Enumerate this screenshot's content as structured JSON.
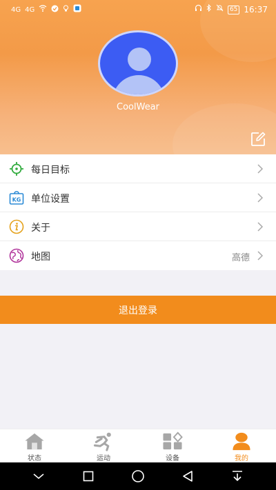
{
  "status_bar": {
    "left_signal_1": "4G",
    "left_signal_2": "4G",
    "battery": "65",
    "time": "16:37"
  },
  "profile": {
    "username": "CoolWear"
  },
  "menu": {
    "items": [
      {
        "label": "每日目标",
        "value": "",
        "icon": "target-icon",
        "color": "#2faa3c"
      },
      {
        "label": "单位设置",
        "value": "",
        "icon": "kg-icon",
        "color": "#2a8ad6"
      },
      {
        "label": "关于",
        "value": "",
        "icon": "info-icon",
        "color": "#e4a11a"
      },
      {
        "label": "地图",
        "value": "高德",
        "icon": "globe-icon",
        "color": "#b0339a"
      }
    ]
  },
  "logout": {
    "label": "退出登录"
  },
  "tabs": [
    {
      "label": "状态",
      "icon": "home-icon",
      "active": false
    },
    {
      "label": "运动",
      "icon": "runner-icon",
      "active": false
    },
    {
      "label": "设备",
      "icon": "devices-icon",
      "active": false
    },
    {
      "label": "我的",
      "icon": "profile-icon",
      "active": true
    }
  ],
  "colors": {
    "accent": "#f28c1c",
    "header_top": "#f7a34f",
    "avatar": "#3c5cf3"
  }
}
